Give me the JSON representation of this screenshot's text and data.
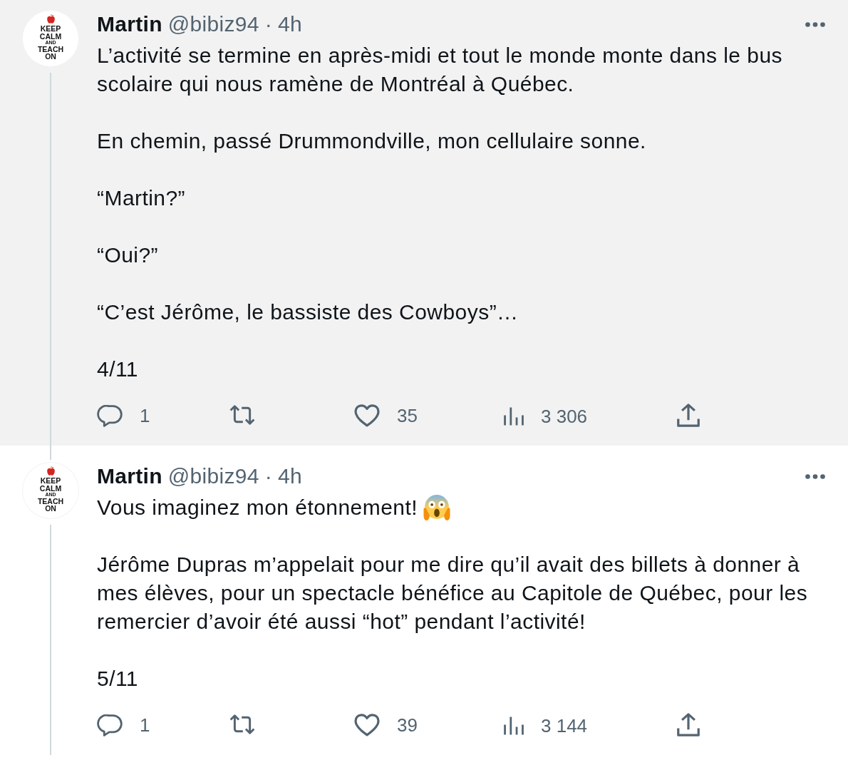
{
  "tweets": [
    {
      "highlighted": true,
      "thread_above": false,
      "thread_below": true,
      "avatar": {
        "lines": [
          "KEEP",
          "CALM",
          "AND",
          "TEACH",
          "ON"
        ]
      },
      "author": {
        "name": "Martin",
        "handle": "@bibiz94",
        "separator": "·",
        "time": "4h"
      },
      "paragraphs": [
        {
          "text": "L’activité se termine en après-midi et tout le monde monte dans le bus scolaire qui nous ramène de Montréal à Québec.",
          "emoji": false
        },
        {
          "text": "En chemin, passé Drummondville, mon cellulaire sonne.",
          "emoji": false
        },
        {
          "text": "“Martin?”",
          "emoji": false
        },
        {
          "text": "“Oui?”",
          "emoji": false
        },
        {
          "text": "“C’est Jérôme, le bassiste des Cowboys”…",
          "emoji": false
        },
        {
          "text": "4/11",
          "emoji": false
        }
      ],
      "actions": [
        {
          "kind": "reply",
          "count": "1"
        },
        {
          "kind": "retweet"
        },
        {
          "kind": "like",
          "count": "35"
        },
        {
          "kind": "views",
          "count": "3 306"
        },
        {
          "kind": "share"
        }
      ]
    },
    {
      "highlighted": false,
      "thread_above": true,
      "thread_below": true,
      "avatar": {
        "lines": [
          "KEEP",
          "CALM",
          "AND",
          "TEACH",
          "ON"
        ]
      },
      "author": {
        "name": "Martin",
        "handle": "@bibiz94",
        "separator": "·",
        "time": "4h"
      },
      "paragraphs": [
        {
          "text": "Vous imaginez mon étonnement!",
          "emoji": true
        },
        {
          "text": "Jérôme Dupras m’appelait pour me dire qu’il avait des billets à donner à mes élèves, pour un spectacle bénéfice au Capitole de Québec, pour les remercier d’avoir été aussi “hot” pendant l’activité!",
          "emoji": false
        },
        {
          "text": "5/11",
          "emoji": false
        }
      ],
      "actions": [
        {
          "kind": "reply",
          "count": "1"
        },
        {
          "kind": "retweet"
        },
        {
          "kind": "like",
          "count": "39"
        },
        {
          "kind": "views",
          "count": "3 144"
        },
        {
          "kind": "share"
        }
      ]
    }
  ]
}
